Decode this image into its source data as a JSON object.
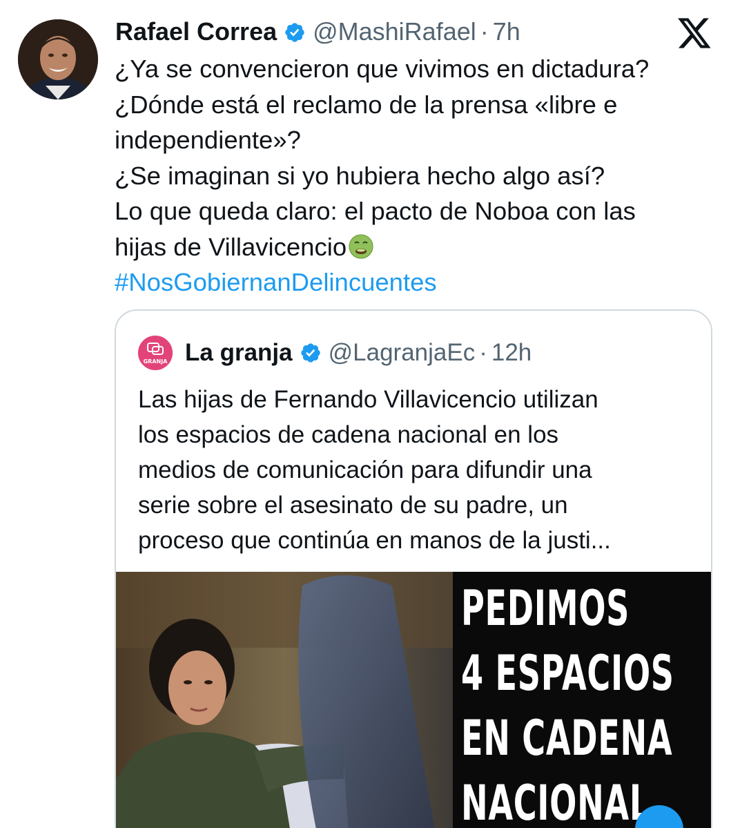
{
  "tweet": {
    "author_name": "Rafael Correa",
    "handle": "@MashiRafael",
    "separator": "·",
    "time": "7h",
    "lines": [
      "¿Ya se convencieron que vivimos en dictadura?",
      "¿Dónde está el reclamo de la prensa «libre e",
      "independiente»?",
      "¿Se imaginan si yo hubiera hecho algo así?",
      "Lo que queda claro: el pacto de Noboa con las",
      "hijas de Villavicencio"
    ],
    "emoji": "nauseated-face-emoji",
    "hashtag": "#NosGobiernanDelincuentes"
  },
  "quoted_tweet": {
    "author_name": "La granja",
    "handle": "@LagranjaEc",
    "separator": "·",
    "time": "12h",
    "avatar_label": "GRANJA",
    "lines": [
      "Las hijas de Fernando Villavicencio utilizan",
      "los espacios de cadena nacional en los",
      "medios de comunicación para difundir una",
      "serie sobre el asesinato de su padre, un",
      "proceso que continúa en manos de la justi..."
    ],
    "media_overlay_lines": [
      "PEDIMOS",
      "4 ESPACIOS",
      "EN CADENA",
      "NACIONAL"
    ]
  },
  "icons": {
    "verified": "verified-badge-icon",
    "x_logo": "x-logo-icon"
  },
  "colors": {
    "accent": "#1d9bf0",
    "text": "#0f1419",
    "secondary": "#536471",
    "border": "#cfd9de",
    "granja_pink": "#e2447a"
  }
}
